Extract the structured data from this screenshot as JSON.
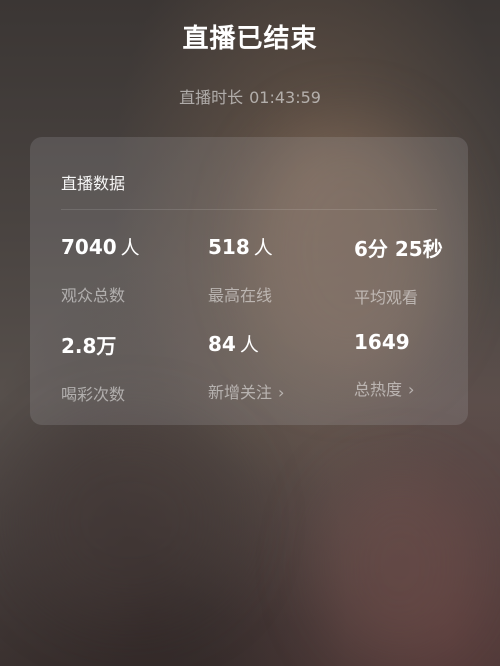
{
  "header": {
    "title": "直播已结束",
    "duration_label": "直播时长",
    "duration_value": "01:43:59"
  },
  "card": {
    "title": "直播数据",
    "stats": [
      {
        "value": "7040",
        "unit": "人",
        "label": "观众总数"
      },
      {
        "value": "518",
        "unit": "人",
        "label": "最高在线"
      },
      {
        "value": "6分 25秒",
        "unit": "",
        "label": "平均观看"
      },
      {
        "value": "2.8万",
        "unit": "",
        "label": "喝彩次数"
      },
      {
        "value": "84",
        "unit": "人",
        "label": "新增关注",
        "link": true
      },
      {
        "value": "1649",
        "unit": "",
        "label": "总热度",
        "link": true
      }
    ],
    "chevron": "›"
  },
  "icons": {
    "chevron": "chevron-right-icon"
  }
}
